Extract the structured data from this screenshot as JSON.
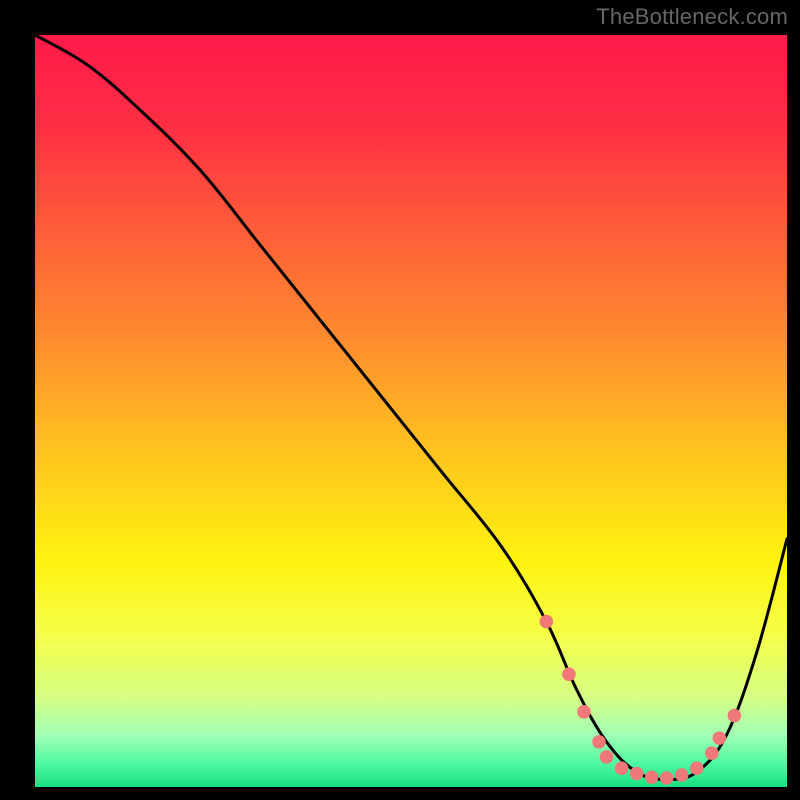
{
  "watermark": "TheBottleneck.com",
  "chart_data": {
    "type": "line",
    "title": "",
    "xlabel": "",
    "ylabel": "",
    "xlim": [
      0,
      100
    ],
    "ylim": [
      0,
      100
    ],
    "grid": false,
    "legend": false,
    "gradient_stops": [
      {
        "offset": 0.0,
        "color": "#ff1a4b"
      },
      {
        "offset": 0.12,
        "color": "#ff2e44"
      },
      {
        "offset": 0.25,
        "color": "#ff5a3a"
      },
      {
        "offset": 0.4,
        "color": "#ff8a2f"
      },
      {
        "offset": 0.55,
        "color": "#ffc21f"
      },
      {
        "offset": 0.7,
        "color": "#fff310"
      },
      {
        "offset": 0.8,
        "color": "#f4ff4a"
      },
      {
        "offset": 0.88,
        "color": "#d7ff84"
      },
      {
        "offset": 0.93,
        "color": "#a2ffb4"
      },
      {
        "offset": 0.97,
        "color": "#4cf9a2"
      },
      {
        "offset": 1.0,
        "color": "#17e07f"
      }
    ],
    "series": [
      {
        "name": "bottleneck-curve",
        "color": "#000000",
        "x": [
          0,
          7,
          14,
          22,
          30,
          38,
          46,
          54,
          62,
          68,
          72,
          76,
          80,
          84,
          88,
          92,
          96,
          100
        ],
        "values": [
          100,
          96,
          90,
          82,
          72,
          62,
          52,
          42,
          32,
          22,
          13,
          6,
          2,
          1,
          2,
          7,
          18,
          33
        ]
      }
    ],
    "markers": {
      "color": "#f07878",
      "radius_pct": 0.9,
      "points": [
        {
          "x": 68,
          "y": 22
        },
        {
          "x": 71,
          "y": 15
        },
        {
          "x": 73,
          "y": 10
        },
        {
          "x": 75,
          "y": 6
        },
        {
          "x": 76,
          "y": 4
        },
        {
          "x": 78,
          "y": 2.5
        },
        {
          "x": 80,
          "y": 1.8
        },
        {
          "x": 82,
          "y": 1.3
        },
        {
          "x": 84,
          "y": 1.2
        },
        {
          "x": 86,
          "y": 1.6
        },
        {
          "x": 88,
          "y": 2.5
        },
        {
          "x": 90,
          "y": 4.5
        },
        {
          "x": 91,
          "y": 6.5
        },
        {
          "x": 93,
          "y": 9.5
        }
      ]
    }
  }
}
